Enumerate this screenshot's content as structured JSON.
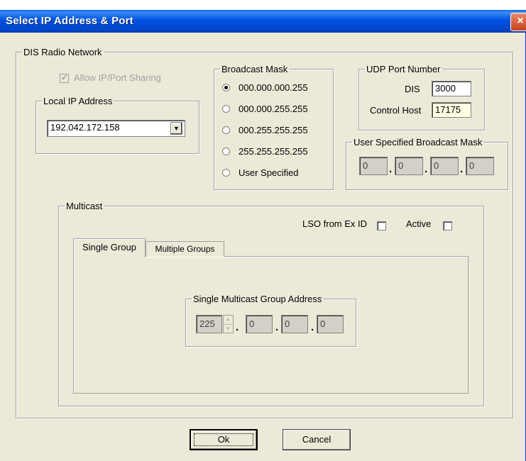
{
  "window": {
    "title": "Select IP Address & Port",
    "close_icon": "×"
  },
  "dis_radio_network": {
    "legend": "DIS Radio Network",
    "allow_sharing": {
      "label": "Allow IP/Port Sharing",
      "checked": true,
      "enabled": false
    },
    "local_ip": {
      "legend": "Local IP Address",
      "value": "192.042.172.158",
      "dropdown_icon": "▼"
    }
  },
  "broadcast_mask": {
    "legend": "Broadcast Mask",
    "options": [
      "000.000.000.255",
      "000.000.255.255",
      "000.255.255.255",
      "255.255.255.255",
      "User Specified"
    ],
    "selected": 0
  },
  "udp_port": {
    "legend": "UDP Port Number",
    "dis_label": "DIS",
    "dis_value": "3000",
    "control_host_label": "Control Host",
    "control_host_value": "17175"
  },
  "user_broadcast_mask": {
    "legend": "User Specified Broadcast Mask",
    "octets": [
      "0",
      "0",
      "0",
      "0"
    ]
  },
  "multicast": {
    "legend": "Multicast",
    "lso_label": "LSO from Ex ID",
    "active_label": "Active",
    "tabs": [
      "Single Group",
      "Multiple Groups"
    ],
    "single_group": {
      "legend": "Single Multicast Group Address",
      "octets": [
        "225",
        "0",
        "0",
        "0"
      ]
    }
  },
  "buttons": {
    "ok": "Ok",
    "cancel": "Cancel"
  }
}
